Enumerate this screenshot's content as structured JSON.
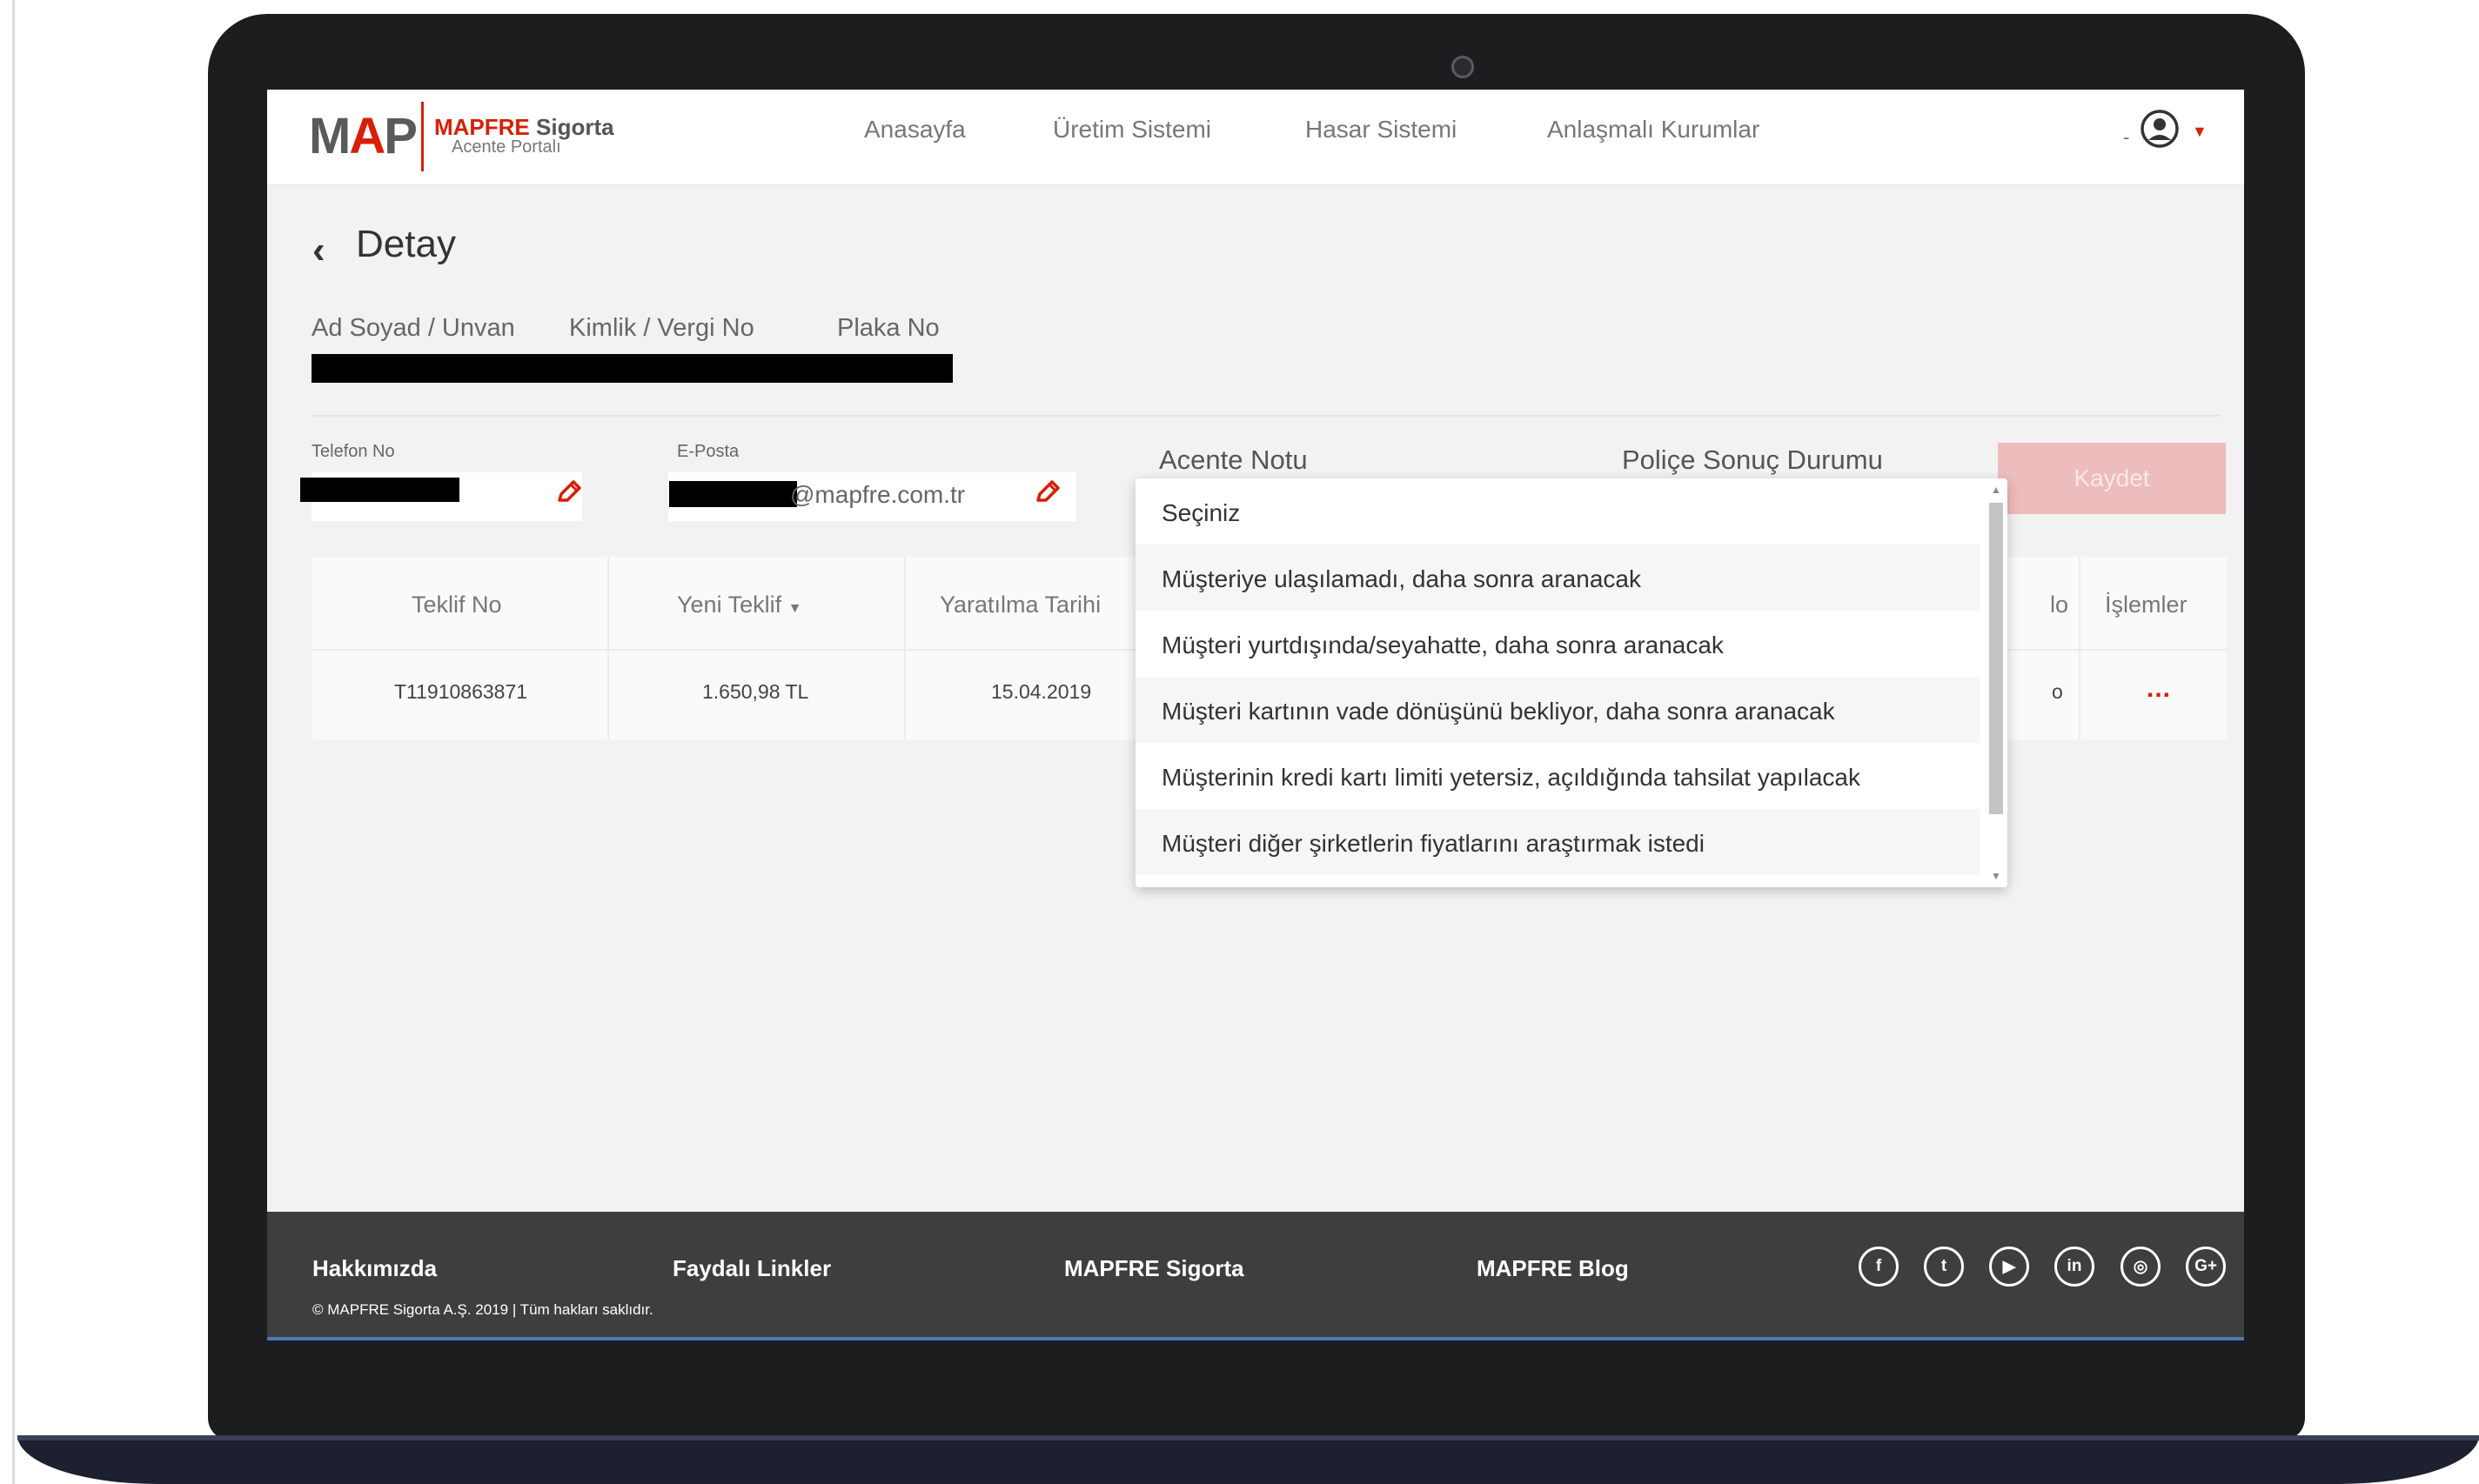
{
  "header": {
    "logo_text_m": "M",
    "logo_text_a": "A",
    "logo_text_p": "P",
    "brand_name": "MAPFRE",
    "brand_suffix": "Sigorta",
    "brand_sub": "Acente Portalı",
    "nav": [
      "Anasayfa",
      "Üretim Sistemi",
      "Hasar Sistemi",
      "Anlaşmalı Kurumlar"
    ],
    "user_prefix": "-"
  },
  "page": {
    "title": "Detay",
    "info_labels": [
      "Ad Soyad / Unvan",
      "Kimlik / Vergi No",
      "Plaka No"
    ]
  },
  "contact": {
    "phone_label": "Telefon No",
    "email_label": "E-Posta",
    "email_suffix": "@mapfre.com.tr",
    "note_label": "Acente Notu",
    "status_label": "Poliçe Sonuç Durumu",
    "save_label": "Kaydet"
  },
  "table": {
    "headers": [
      "Teklif No",
      "Yeni Teklif",
      "Yaratılma Tarihi",
      "İşlemler"
    ],
    "partial_header": "lo",
    "row": {
      "teklif_no": "T11910863871",
      "yeni_teklif": "1.650,98 TL",
      "tarih": "15.04.2019",
      "partial_cell": "o",
      "actions": "..."
    }
  },
  "dropdown": {
    "options": [
      "Seçiniz",
      "Müşteriye ulaşılamadı, daha sonra aranacak",
      "Müşteri yurtdışında/seyahatte, daha sonra aranacak",
      "Müşteri kartının vade dönüşünü bekliyor, daha sonra aranacak",
      "Müşterinin kredi kartı limiti yetersiz, açıldığında tahsilat yapılacak",
      "Müşteri diğer şirketlerin fiyatlarını araştırmak istedi"
    ]
  },
  "footer": {
    "links": [
      "Hakkımızda",
      "Faydalı Linkler",
      "MAPFRE Sigorta",
      "MAPFRE Blog"
    ],
    "copyright": "© MAPFRE Sigorta A.Ş. 2019 | Tüm hakları saklıdır.",
    "social_icons": [
      "facebook-icon",
      "twitter-icon",
      "youtube-icon",
      "linkedin-icon",
      "instagram-icon",
      "google-plus-icon"
    ],
    "social_glyphs": [
      "f",
      "t",
      "▶",
      "in",
      "◎",
      "G+"
    ]
  },
  "colors": {
    "accent": "#d81e05",
    "save_disabled": "#edbcbc",
    "footer_bg": "#3e3e3e"
  }
}
